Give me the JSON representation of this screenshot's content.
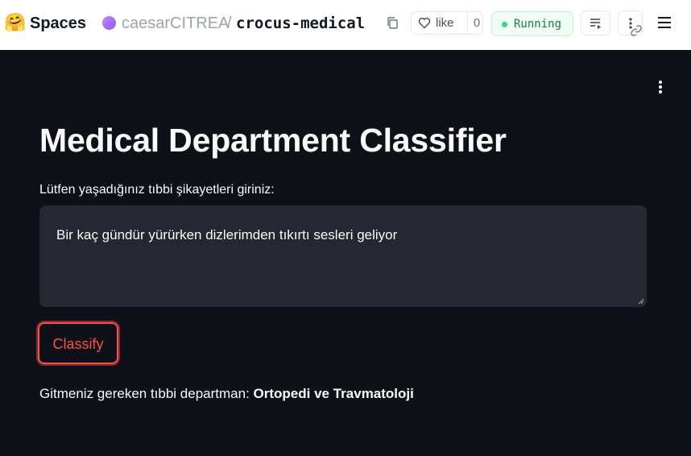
{
  "header": {
    "brand": "Spaces",
    "owner": "caesarCITREA",
    "separator": "/",
    "repo": "crocus-medical",
    "like_label": "like",
    "like_count": "0",
    "status": "Running",
    "brand_icon": "hugging-face-logo",
    "colors": {
      "status_dot": "#34d399",
      "status_text": "#15803d",
      "org_avatar": "#a78bfa"
    }
  },
  "app": {
    "title": "Medical Department Classifier",
    "input_label": "Lütfen yaşadığınız tıbbi şikayetleri giriniz:",
    "input_value": "Bir kaç gündür yürürken dizlerimden tıkırtı sesleri geliyor",
    "button_label": "Classify",
    "result_prefix": "Gitmeniz gereken tıbbi departman: ",
    "result_value": "Ortopedi ve Travmatoloji",
    "colors": {
      "background": "#0e1117",
      "input_background": "#262730",
      "accent": "#ff4b4b"
    }
  }
}
